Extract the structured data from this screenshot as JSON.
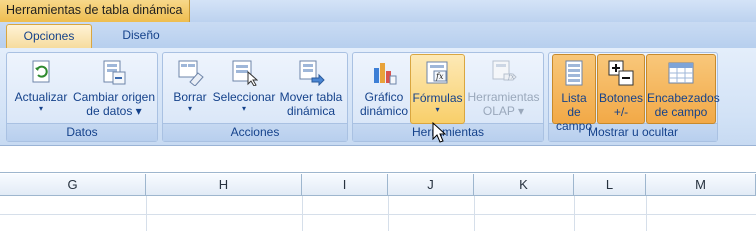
{
  "context_title": "Herramientas de tabla dinámica",
  "tabs": [
    {
      "label": "Opciones",
      "active": true
    },
    {
      "label": "Diseño",
      "active": false
    }
  ],
  "groups": {
    "datos": {
      "label": "Datos",
      "buttons": [
        {
          "line1": "Actualizar",
          "line2": "",
          "icon": "refresh-icon",
          "caret": "▾"
        },
        {
          "line1": "Cambiar origen",
          "line2": "de datos ▾",
          "icon": "change-source-icon",
          "caret": ""
        }
      ]
    },
    "acciones": {
      "label": "Acciones",
      "buttons": [
        {
          "line1": "Borrar",
          "line2": "",
          "icon": "eraser-icon",
          "caret": "▾"
        },
        {
          "line1": "Seleccionar",
          "line2": "",
          "icon": "select-icon",
          "caret": "▾"
        },
        {
          "line1": "Mover tabla",
          "line2": "dinámica",
          "icon": "move-table-icon",
          "caret": ""
        }
      ]
    },
    "herramientas": {
      "label": "Herramientas",
      "buttons": [
        {
          "line1": "Gráfico",
          "line2": "dinámico",
          "icon": "pivot-chart-icon",
          "caret": ""
        },
        {
          "line1": "Fórmulas",
          "line2": "",
          "icon": "formula-icon",
          "caret": "▾"
        },
        {
          "line1": "Herramientas",
          "line2": "OLAP ▾",
          "icon": "olap-icon",
          "caret": ""
        }
      ]
    },
    "mostrar": {
      "label": "Mostrar u ocultar",
      "buttons": [
        {
          "line1": "Lista de",
          "line2": "campo",
          "icon": "field-list-icon"
        },
        {
          "line1": "Botones",
          "line2": "+/-",
          "icon": "plus-minus-icon"
        },
        {
          "line1": "Encabezados",
          "line2": "de campo",
          "icon": "field-headers-icon"
        }
      ]
    }
  },
  "columns": [
    "G",
    "H",
    "I",
    "J",
    "K",
    "L",
    "M"
  ],
  "colors": {
    "accent_orange": "#f2a947",
    "ribbon_blue": "#d2e2f6",
    "text_blue": "#15428b"
  }
}
